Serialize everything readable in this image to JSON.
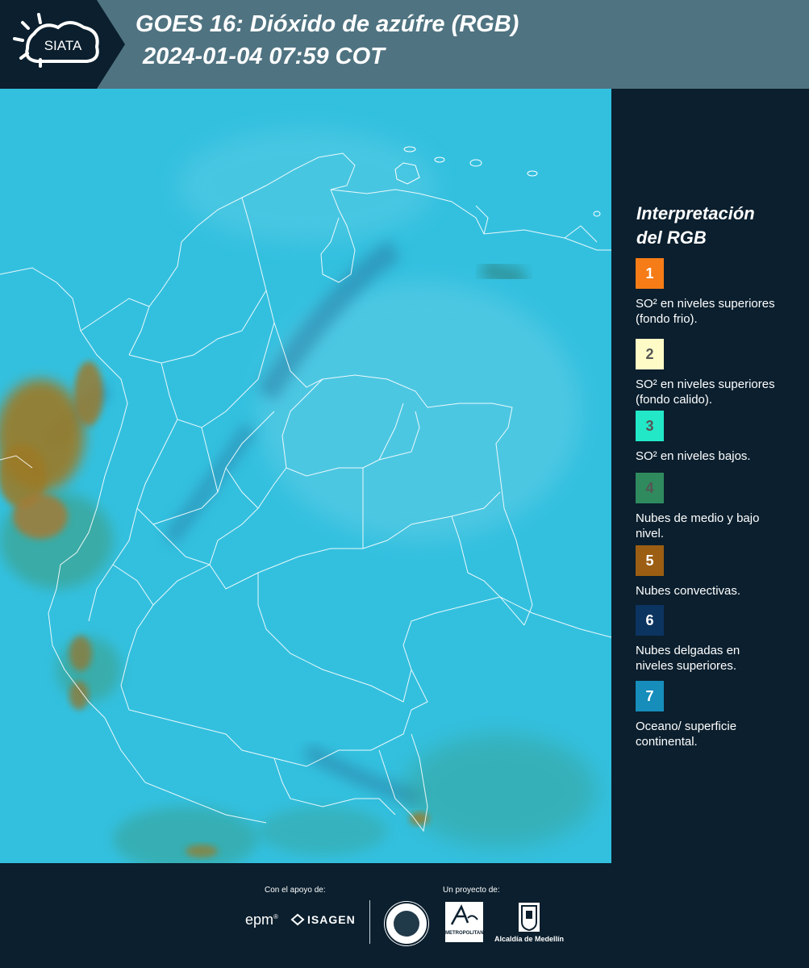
{
  "header": {
    "logo_text": "SIATA",
    "title_line1": "GOES 16: Dióxido de azúfre (RGB)",
    "title_line2": "2024-01-04 07:59 COT"
  },
  "legend": {
    "title_line1": "Interpretación",
    "title_line2": "del RGB",
    "items": [
      {
        "number": "1",
        "color": "#f57c17",
        "text": "SO² en niveles superiores (fondo frio)."
      },
      {
        "number": "2",
        "color": "#fffbc7",
        "text": "SO² en niveles superiores (fondo calido)."
      },
      {
        "number": "3",
        "color": "#23e8c8",
        "text": "SO² en niveles bajos."
      },
      {
        "number": "4",
        "color": "#2f8a5e",
        "text": "Nubes de medio y bajo nivel."
      },
      {
        "number": "5",
        "color": "#9c5e12",
        "text": "Nubes convectivas."
      },
      {
        "number": "6",
        "color": "#0c3460",
        "text": "Nubes delgadas en niveles superiores."
      },
      {
        "number": "7",
        "color": "#168dbb",
        "text": "Oceano/ superficie continental."
      }
    ]
  },
  "footer": {
    "support_label": "Con el apoyo de:",
    "project_label": "Un proyecto de:",
    "epm": "epm",
    "isagen": "ISAGEN",
    "area_label": "METROPOLITANA",
    "alcaldia": "Alcaldía de Medellín"
  },
  "colors": {
    "background": "#0b1f2e",
    "header": "#4f7381",
    "map_base": "#33c0df"
  }
}
